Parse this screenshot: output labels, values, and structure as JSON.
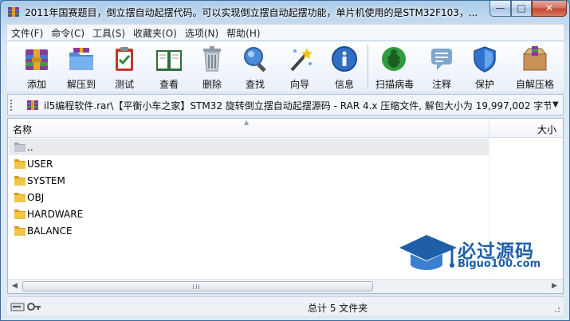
{
  "window": {
    "title": "2011年国赛题目，倒立摆自动起摆代码。可以实现倒立摆自动起摆功能，单片机使用的是STM32F103，...",
    "controls": {
      "minimize": "—",
      "maximize": "□",
      "close": "✕"
    }
  },
  "menu": [
    "文件(F)",
    "命令(C)",
    "工具(S)",
    "收藏夹(O)",
    "选项(N)",
    "帮助(H)"
  ],
  "toolbar": {
    "add": "添加",
    "extract": "解压到",
    "test": "测试",
    "view": "查看",
    "delete": "删除",
    "find": "查找",
    "wizard": "向导",
    "info": "信息",
    "virus_scan": "扫描病毒",
    "comment": "注释",
    "protect": "保护",
    "sfx": "自解压格"
  },
  "address": {
    "path": "il5编程软件.rar\\【平衡小车之家】STM32  旋转倒立摆自动起摆源码 - RAR 4.x 压缩文件, 解包大小为 19,997,002 字节"
  },
  "columns": {
    "name": "名称",
    "size": "大小"
  },
  "files": [
    {
      "name": "..",
      "type": "parent"
    },
    {
      "name": "USER",
      "type": "folder"
    },
    {
      "name": "SYSTEM",
      "type": "folder"
    },
    {
      "name": "OBJ",
      "type": "folder"
    },
    {
      "name": "HARDWARE",
      "type": "folder"
    },
    {
      "name": "BALANCE",
      "type": "folder"
    }
  ],
  "status": {
    "summary": "总计 5 文件夹"
  },
  "watermark": {
    "title": "必过源码",
    "subtitle": "Biguo100.com"
  },
  "colors": {
    "accent": "#1f5fa8",
    "folder": "#e8b33a",
    "title_bar": "#a9cbe9",
    "close_button": "#c1452c"
  }
}
